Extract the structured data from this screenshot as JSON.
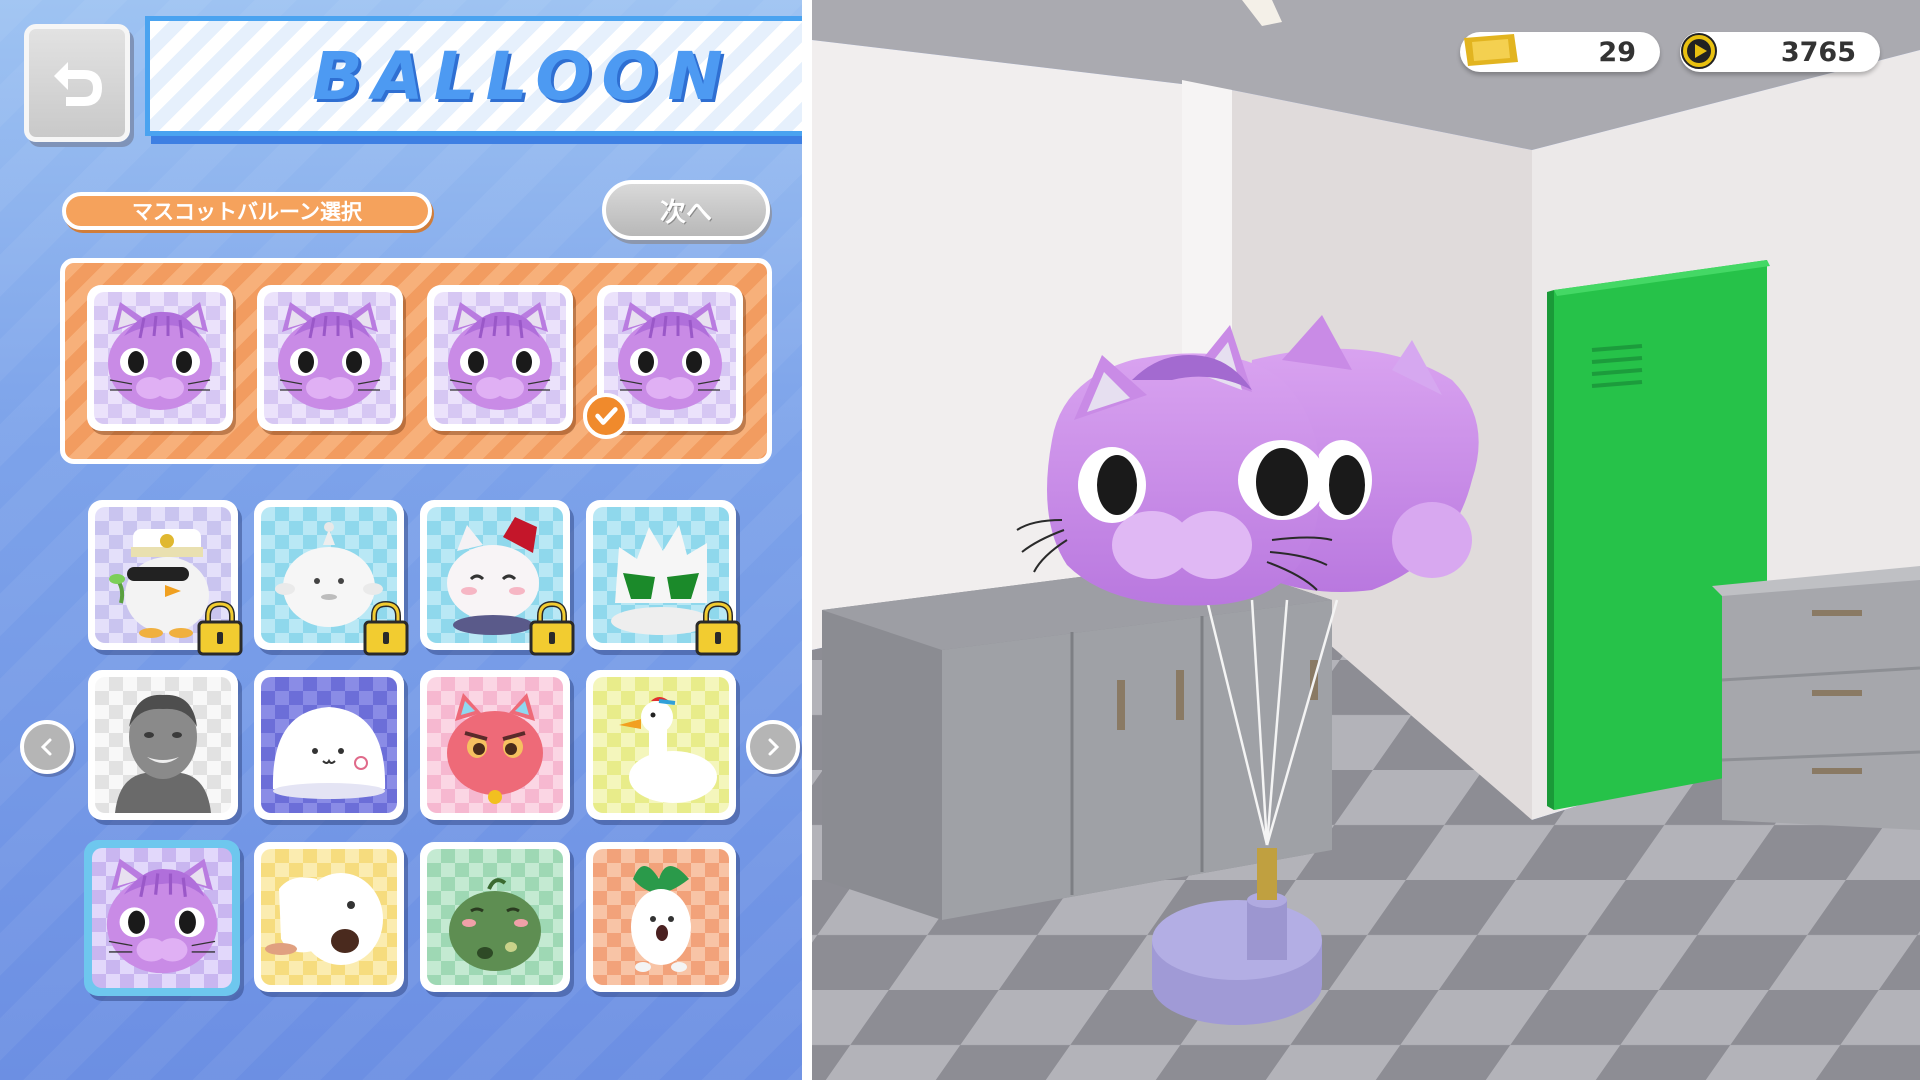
{
  "header": {
    "title": "BALLOON",
    "back_icon": "return-arrow-icon"
  },
  "section": {
    "label": "マスコットバルーン選択",
    "next_label": "次へ"
  },
  "selected_slots": [
    {
      "mascot": "purple-cat",
      "checked": false
    },
    {
      "mascot": "purple-cat",
      "checked": false
    },
    {
      "mascot": "purple-cat",
      "checked": false
    },
    {
      "mascot": "purple-cat",
      "checked": true
    }
  ],
  "mascot_grid": [
    {
      "mascot": "penguin-captain",
      "bg": "lavender",
      "locked": true
    },
    {
      "mascot": "white-blob-sprout",
      "bg": "cyan",
      "locked": true
    },
    {
      "mascot": "white-cat-crown",
      "bg": "cyan",
      "locked": true
    },
    {
      "mascot": "spiky-white-green",
      "bg": "cyan",
      "locked": true
    },
    {
      "mascot": "stone-bust",
      "bg": "white",
      "locked": false
    },
    {
      "mascot": "white-mochi",
      "bg": "violet",
      "locked": false
    },
    {
      "mascot": "pink-cat",
      "bg": "pink",
      "locked": false
    },
    {
      "mascot": "white-duck",
      "bg": "yellow",
      "locked": false
    },
    {
      "mascot": "purple-cat",
      "bg": "lavender",
      "locked": false,
      "selected": true
    },
    {
      "mascot": "white-dog",
      "bg": "yellow",
      "locked": false
    },
    {
      "mascot": "green-frog",
      "bg": "green",
      "locked": false
    },
    {
      "mascot": "radish",
      "bg": "orange",
      "locked": false
    }
  ],
  "currency": {
    "tickets": "29",
    "coins": "3765",
    "ticket_icon": "gold-ticket-icon",
    "coin_icon": "gold-coin-play-icon"
  },
  "colors": {
    "title_blue": "#4d9af2",
    "accent_orange": "#f5a25c",
    "balloon_purple": "#c98be6",
    "locker_green": "#28c24a"
  }
}
